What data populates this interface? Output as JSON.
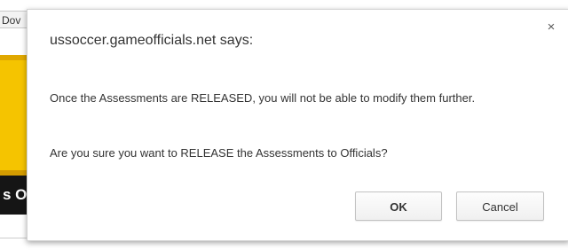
{
  "background_page": {
    "tab_text": "Dov",
    "banner_text": "s O",
    "colors": {
      "banner_yellow": "#f5c400",
      "banner_black": "#151515"
    }
  },
  "dialog": {
    "title": "ussoccer.gameofficials.net says:",
    "close_icon": "close-icon",
    "close_glyph": "×",
    "message_line_1": "Once the Assessments are RELEASED, you will not be able to modify them further.",
    "message_line_2": "Are you sure you want to RELEASE the Assessments to Officials?",
    "buttons": {
      "ok_label": "OK",
      "cancel_label": "Cancel"
    }
  }
}
